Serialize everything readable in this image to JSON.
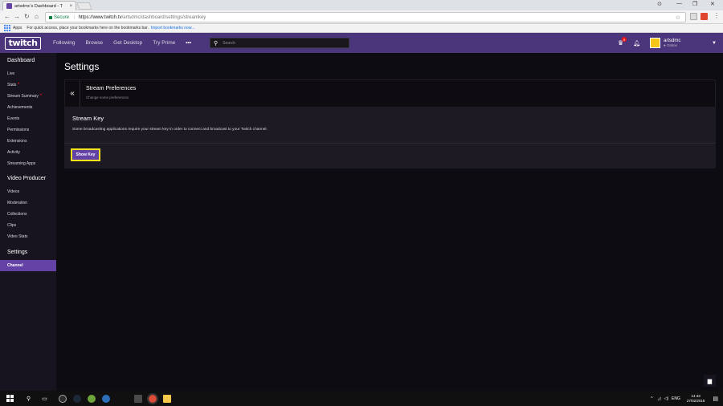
{
  "browser": {
    "tab_title": "artsdmc's Dashboard - T",
    "tab_close": "×",
    "secure_label": "Secure",
    "url_main": "https://www.twitch.tv",
    "url_path": "/artsdmc/dashboard/settings/streamkey",
    "bookmarks_apps": "Apps",
    "bookmarks_hint": "For quick access, place your bookmarks here on the bookmarks bar.",
    "bookmarks_import": "Import bookmarks now...",
    "window_controls": [
      "—",
      "❐",
      "✕"
    ]
  },
  "topnav": {
    "logo_text": "twitch",
    "links": [
      "Following",
      "Browse",
      "Get Desktop",
      "Try Prime"
    ],
    "more": "•••",
    "search_placeholder": "Search",
    "notification_count": "5",
    "username": "artsdmc",
    "user_status": "● Online"
  },
  "sidebar": {
    "dashboard": {
      "title": "Dashboard",
      "items": [
        "Live",
        "Stats",
        "Stream Summary",
        "Achievements",
        "Events",
        "Permissions",
        "Extensions",
        "Activity",
        "Streaming Apps"
      ]
    },
    "video_producer": {
      "title": "Video Producer",
      "items": [
        "Videos",
        "Moderation",
        "Collections",
        "Clips",
        "Video Stats"
      ]
    },
    "settings": {
      "title": "Settings",
      "items": [
        "Channel"
      ]
    }
  },
  "main": {
    "page_title": "Settings",
    "back_glyph": "«",
    "pref_title": "Stream Preferences",
    "pref_subtitle": "Change some preferences",
    "stream_key_title": "Stream Key",
    "stream_key_desc": "Some broadcasting applications require your stream key in order to connect and broadcast to your Twitch channel.",
    "show_key_label": "Show Key"
  },
  "taskbar": {
    "lang": "ENG",
    "time": "14:43",
    "date": "27/02/2018"
  },
  "colors": {
    "twitch_purple": "#6441a4",
    "nav_bg": "#4b367c",
    "highlight_border": "#f5e31c"
  }
}
